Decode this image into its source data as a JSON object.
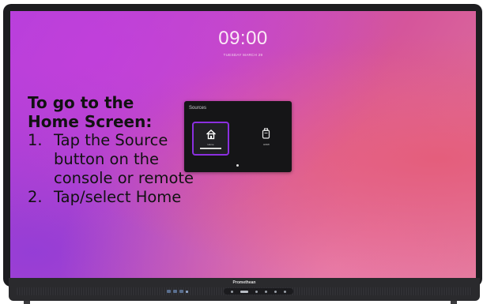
{
  "screen": {
    "clock": "09:00",
    "date": "TUESDAY MARCH 29"
  },
  "instructions": {
    "heading_line1": "To go to the",
    "heading_line2": "Home Screen:",
    "steps": [
      {
        "number": "1.",
        "lines": [
          "Tap the Source",
          "button on the",
          "console or remote"
        ]
      },
      {
        "number": "2.",
        "lines": [
          "Tap/select Home"
        ]
      }
    ]
  },
  "sources_panel": {
    "title": "Sources",
    "items": [
      {
        "label": "Home",
        "icon": "home-icon",
        "selected": true
      },
      {
        "label": "HDMI",
        "icon": "hdmi-icon",
        "selected": false
      }
    ],
    "accent_color": "#8b2fe0"
  },
  "console": {
    "brand": "Promethean"
  }
}
